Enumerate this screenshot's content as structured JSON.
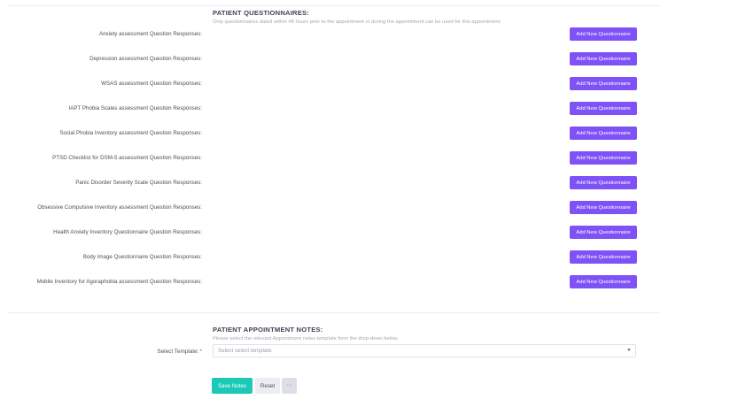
{
  "questionnaires": {
    "title": "PATIENT QUESTIONNAIRES:",
    "note": "Only questionnaires dated within 48 hours prior to the appointment or during the appointment can be used for this appointment.",
    "add_label": "Add New Questionnaire",
    "items": [
      {
        "label": "Anxiety assessment Question Responses:"
      },
      {
        "label": "Depression assessment Question Responses:"
      },
      {
        "label": "WSAS assessment Question Responses:"
      },
      {
        "label": "IAPT Phobia Scales assessment Question Responses:"
      },
      {
        "label": "Social Phobia Inventory assessment Question Responses:"
      },
      {
        "label": "PTSD Checklist for DSM-5 assessment Question Responses:"
      },
      {
        "label": "Panic Disorder Severity Scale Question Responses:"
      },
      {
        "label": "Obsessive Compulsive Inventory assessment Question Responses:"
      },
      {
        "label": "Health Anxiety Inventory Questionnaire Question Responses:"
      },
      {
        "label": "Body Image Questionnaire Question Responses:"
      },
      {
        "label": "Mobile Inventory for Agoraphobia assessment Question Responses:"
      }
    ]
  },
  "notes": {
    "title": "PATIENT APPOINTMENT NOTES:",
    "note": "Please select the relevant Appointment notes template form the drop-down below.",
    "template_label": "Select Template:",
    "required_mark": "*",
    "template_placeholder": "Select select template",
    "save_label": "Save Notes",
    "reset_label": "Reset",
    "more_label": "···"
  },
  "colors": {
    "add_button": "#7e52f6",
    "save_button": "#1bc9b6"
  }
}
